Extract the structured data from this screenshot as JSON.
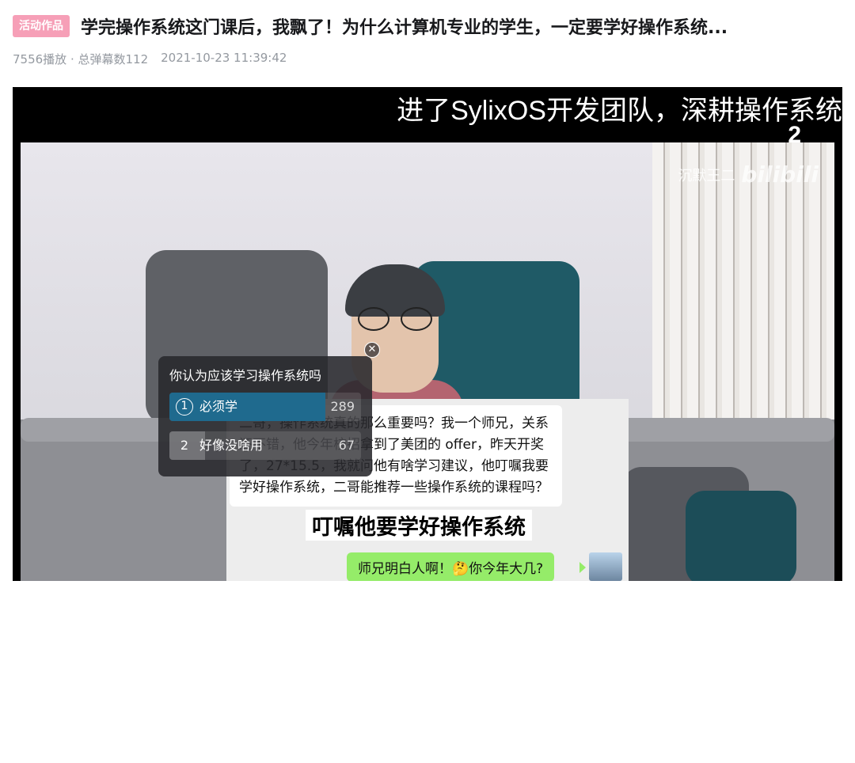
{
  "header": {
    "badge": "活动作品",
    "title": "学完操作系统这门课后，我飘了！为什么计算机专业的学生，一定要学好操作系统...",
    "stats": "7556播放 · 总弹幕数112",
    "datetime": "2021-10-23 11:39:42"
  },
  "video": {
    "top_subtitle": "进了SylixOS开发团队，深耕操作系统",
    "subtitle_fragment": "2",
    "watermark_text": "沉默王二",
    "watermark_logo": "bilibili",
    "chat": {
      "message": "二哥，操作系统真的那么重要吗？我一个师兄，关系还不错，他今年校招拿到了美团的 offer，昨天开奖了，27*15.5，我就问他有啥学习建议，他叮嘱我要学好操作系统，二哥能推荐一些操作系统的课程吗？",
      "reply": "师兄明白人啊！🤔你今年大几?"
    },
    "caption": "叮嘱他要学好操作系统"
  },
  "poll": {
    "question": "你认为应该学习操作系统吗",
    "options": [
      {
        "index": "1",
        "label": "必须学",
        "count": "289",
        "share": 0.812,
        "selected": true
      },
      {
        "index": "2",
        "label": "好像没啥用",
        "count": "67",
        "share": 0.188,
        "selected": false
      }
    ],
    "close_icon": "close-icon"
  },
  "colors": {
    "badge": "#f69fb7",
    "poll_fill": "#1f6a8e",
    "wechat_green": "#95ec69"
  }
}
